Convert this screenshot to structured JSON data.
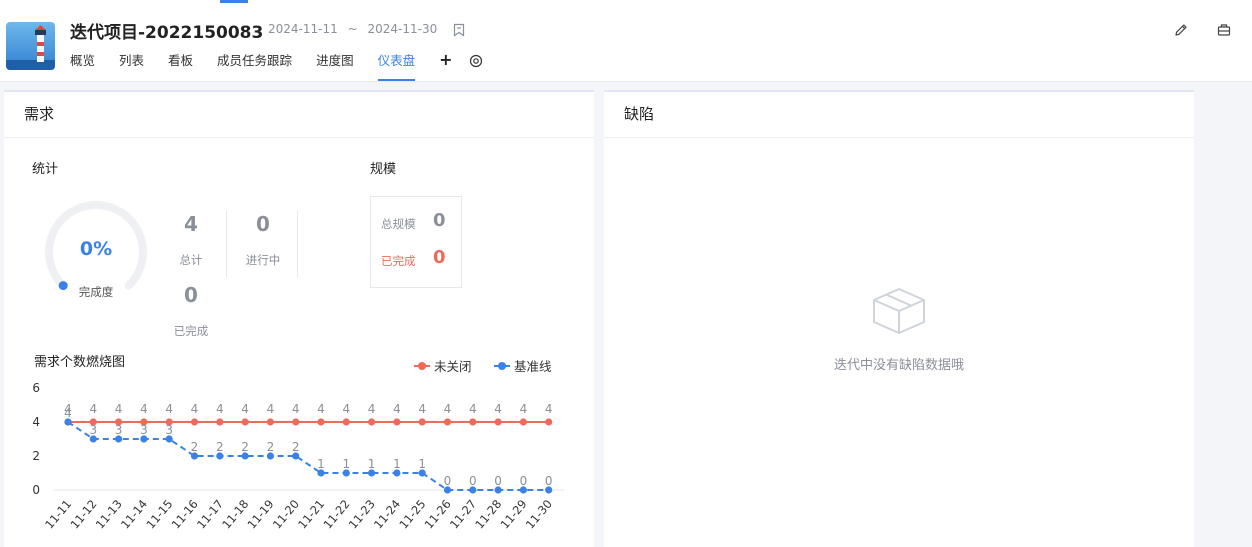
{
  "project": {
    "title": "迭代项目-2022150083",
    "start_date": "2024-11-11",
    "date_sep": "~",
    "end_date": "2024-11-30"
  },
  "tabs": [
    {
      "label": "概览"
    },
    {
      "label": "列表"
    },
    {
      "label": "看板"
    },
    {
      "label": "成员任务跟踪"
    },
    {
      "label": "进度图"
    },
    {
      "label": "仪表盘"
    }
  ],
  "active_tab": "仪表盘",
  "tab_plus": "+",
  "icons": {
    "bookmark": "bookmark-icon",
    "gear": "gear-icon",
    "edit": "edit-icon",
    "export": "export-icon",
    "empty": "empty-box-icon"
  },
  "colors": {
    "accent": "#3b82e8",
    "danger": "#ee6a5a",
    "muted": "#8a8f99"
  },
  "requirements": {
    "title": "需求",
    "stats_title": "统计",
    "completion_pct": "0%",
    "completion_value": 0,
    "completion_label": "完成度",
    "total_value": "4",
    "total_label": "总计",
    "in_progress_value": "0",
    "in_progress_label": "进行中",
    "done_value": "0",
    "done_label": "已完成",
    "scale_title": "规模",
    "scale_total_label": "总规模",
    "scale_total_value": "0",
    "scale_done_label": "已完成",
    "scale_done_value": "0",
    "burndown_title": "需求个数燃烧图"
  },
  "defects": {
    "title": "缺陷",
    "empty_text": "迭代中没有缺陷数据哦"
  },
  "chart_data": {
    "type": "line",
    "title": "需求个数燃烧图",
    "categories": [
      "11-11",
      "11-12",
      "11-13",
      "11-14",
      "11-15",
      "11-16",
      "11-17",
      "11-18",
      "11-19",
      "11-20",
      "11-21",
      "11-22",
      "11-23",
      "11-24",
      "11-25",
      "11-26",
      "11-27",
      "11-28",
      "11-29",
      "11-30"
    ],
    "series": [
      {
        "name": "未关闭",
        "color": "#ee6a5a",
        "style": "solid",
        "values": [
          4,
          4,
          4,
          4,
          4,
          4,
          4,
          4,
          4,
          4,
          4,
          4,
          4,
          4,
          4,
          4,
          4,
          4,
          4,
          4
        ]
      },
      {
        "name": "基准线",
        "color": "#3b82e8",
        "style": "dashed",
        "values": [
          4,
          3,
          3,
          3,
          3,
          2,
          2,
          2,
          2,
          2,
          1,
          1,
          1,
          1,
          1,
          0,
          0,
          0,
          0,
          0
        ]
      }
    ],
    "ylim": [
      0,
      6
    ],
    "yticks": [
      "0",
      "2",
      "4",
      "6"
    ],
    "grid": false,
    "legend": "top-right",
    "xlabel": "",
    "ylabel": ""
  }
}
